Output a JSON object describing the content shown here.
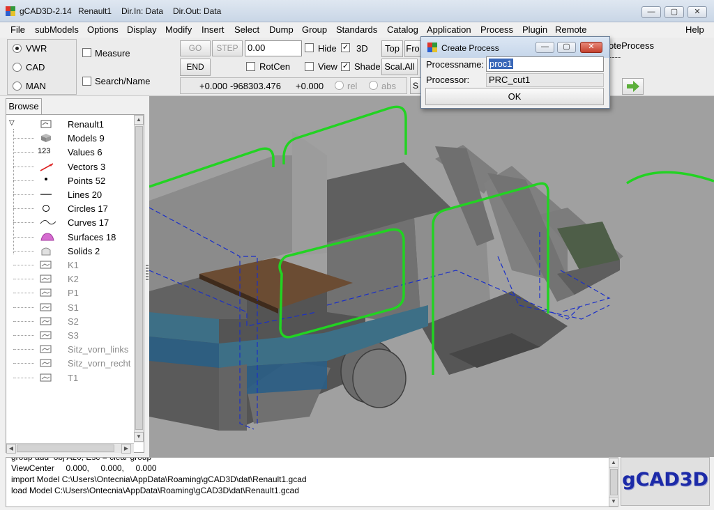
{
  "window": {
    "app_title": "gCAD3D-2.14",
    "model_name": "Renault1",
    "dir_in": "Dir.In: Data",
    "dir_out": "Dir.Out: Data",
    "controls": {
      "minimize": "—",
      "maximize": "▢",
      "close": "✕"
    }
  },
  "menu": [
    "File",
    "subModels",
    "Options",
    "Display",
    "Modify",
    "Insert",
    "Select",
    "Dump",
    "Group",
    "Standards",
    "Catalog",
    "Application",
    "Process",
    "Plugin",
    "Remote"
  ],
  "menu_help": "Help",
  "toolbar": {
    "modes": [
      {
        "label": "VWR",
        "selected": true
      },
      {
        "label": "CAD",
        "selected": false
      },
      {
        "label": "MAN",
        "selected": false
      }
    ],
    "measure": "Measure",
    "search_name": "Search/Name",
    "go": "GO",
    "step": "STEP",
    "end": "END",
    "value_field": "0.00",
    "hide": "Hide",
    "view_3d": "3D",
    "rotcen": "RotCen",
    "view": "View",
    "shade": "Shade",
    "top": "Top",
    "front_partial": "Fro",
    "scale_all": "Scal.All",
    "coord_x": "+0.000",
    "coord_y": "-968303.476",
    "coord_z": "+0.000",
    "rel": "rel",
    "abs": "abs",
    "s_partial": "S",
    "remote_process_partial": "oteProcess",
    "remote_process_dashes": "----",
    "checked": {
      "3d": true,
      "view": true,
      "shade": true
    }
  },
  "browse_tab": "Browse",
  "tree": [
    {
      "label": "Renault1",
      "icon": "model-box-icon",
      "grey": false,
      "root": true
    },
    {
      "label": "Models 9",
      "icon": "models-cube-icon",
      "grey": false
    },
    {
      "label": "Values 6",
      "icon": "values-123-icon",
      "grey": false,
      "glyph": "123"
    },
    {
      "label": "Vectors 3",
      "icon": "vector-arrow-icon",
      "grey": false
    },
    {
      "label": "Points 52",
      "icon": "point-dot-icon",
      "grey": false
    },
    {
      "label": "Lines 20",
      "icon": "line-icon",
      "grey": false
    },
    {
      "label": "Circles 17",
      "icon": "circle-icon",
      "grey": false
    },
    {
      "label": "Curves 17",
      "icon": "curve-icon",
      "grey": false
    },
    {
      "label": "Surfaces 18",
      "icon": "surface-icon",
      "grey": false
    },
    {
      "label": "Solids 2",
      "icon": "solid-icon",
      "grey": false
    },
    {
      "label": "K1",
      "icon": "submodel-icon",
      "grey": true
    },
    {
      "label": "K2",
      "icon": "submodel-icon",
      "grey": true
    },
    {
      "label": "P1",
      "icon": "submodel-icon",
      "grey": true
    },
    {
      "label": "S1",
      "icon": "submodel-icon",
      "grey": true
    },
    {
      "label": "S2",
      "icon": "submodel-icon",
      "grey": true
    },
    {
      "label": "S3",
      "icon": "submodel-icon",
      "grey": true
    },
    {
      "label": "Sitz_vorn_links",
      "icon": "submodel-icon",
      "grey": true
    },
    {
      "label": "Sitz_vorn_recht",
      "icon": "submodel-icon",
      "grey": true
    },
    {
      "label": "T1",
      "icon": "submodel-icon",
      "grey": true
    }
  ],
  "console": [
    "group add  obj A20, Esc = clear group",
    "ViewCenter     0.000,     0.000,     0.000",
    "import Model C:\\Users\\Ontecnia\\AppData\\Roaming\\gCAD3D\\dat\\Renault1.gcad",
    "load Model C:\\Users\\Ontecnia\\AppData\\Roaming\\gCAD3D\\dat\\Renault1.gcad"
  ],
  "logo_text": "gCAD3D",
  "dialog": {
    "title": "Create Process",
    "processname_label": "Processname:",
    "processname_value": "proc1",
    "processor_label": "Processor:",
    "processor_value": "PRC_cut1",
    "ok": "OK"
  },
  "colors": {
    "viewport_bg": "#a0a0a0",
    "green_outline": "#22d322",
    "blue_dashed": "#1a2fc8",
    "logo_text": "#1c2aa8"
  }
}
